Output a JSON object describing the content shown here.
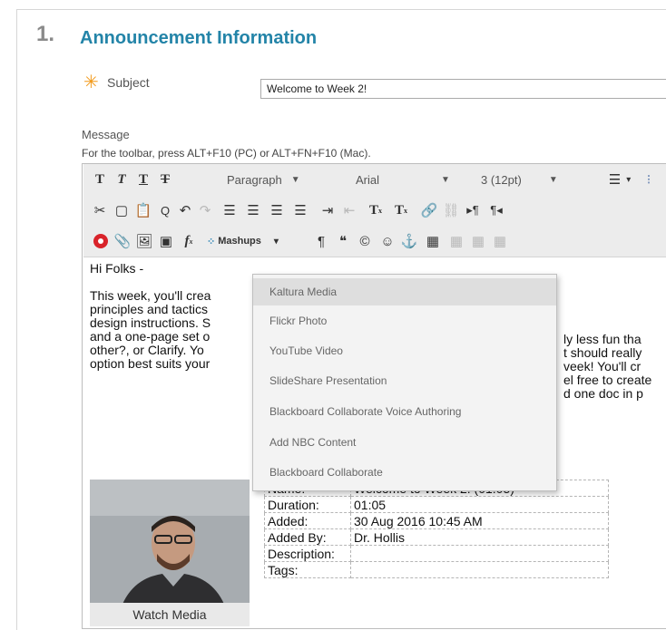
{
  "section": {
    "number": "1.",
    "title": "Announcement Information"
  },
  "subject": {
    "label": "Subject",
    "value": "Welcome to Week 2!"
  },
  "message": {
    "label": "Message",
    "hint": "For the toolbar, press ALT+F10 (PC) or ALT+FN+F10 (Mac)."
  },
  "toolbar": {
    "row1": {
      "format": "Paragraph",
      "font": "Arial",
      "size": "3 (12pt)"
    },
    "mashups_label": "Mashups"
  },
  "mashups_menu": [
    "Kaltura Media",
    "Flickr Photo",
    "YouTube Video",
    "SlideShare Presentation",
    "Blackboard Collaborate Voice Authoring",
    "Add NBC Content",
    "Blackboard Collaborate"
  ],
  "body": {
    "greeting": "Hi Folks -",
    "lines": [
      "This week, you'll crea",
      "principles and tactics",
      "design instructions. S",
      "and a one-page set o",
      "other?, or Clarify.  Yo",
      "option best suits your"
    ],
    "right_lines": [
      "ly less fun tha",
      "t should really",
      "veek!  You'll cr",
      "el free to create",
      "d one doc in p",
      ""
    ]
  },
  "media": {
    "watch_label": "Watch Media",
    "rows": [
      {
        "k": "Name:",
        "v": "Welcome to Week 2! (01:05)"
      },
      {
        "k": "Duration:",
        "v": "01:05"
      },
      {
        "k": "Added:",
        "v": "30 Aug 2016 10:45 AM"
      },
      {
        "k": "Added By:",
        "v": "Dr. Hollis"
      },
      {
        "k": "Description:",
        "v": ""
      },
      {
        "k": "Tags:",
        "v": ""
      }
    ]
  }
}
